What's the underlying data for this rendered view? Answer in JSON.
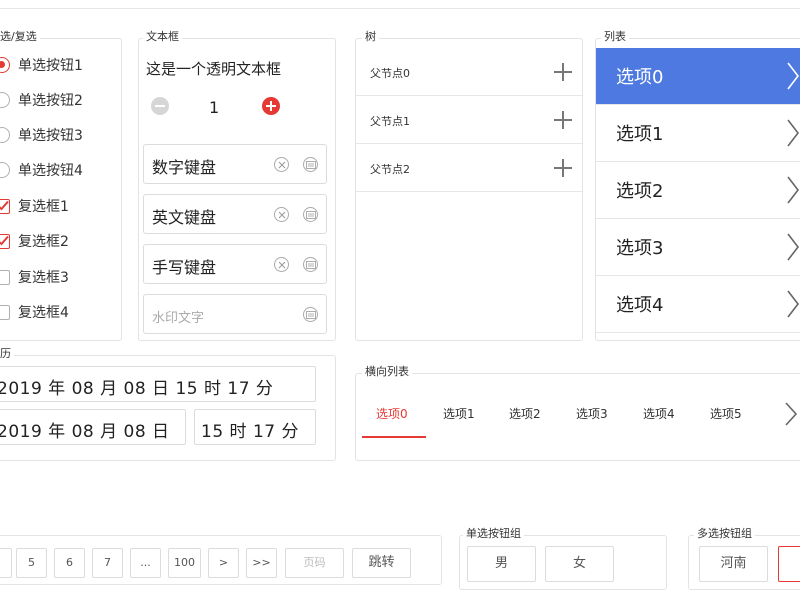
{
  "radio_panel": {
    "title": "选/复选",
    "radios": [
      {
        "label": "单选按钮1",
        "checked": true
      },
      {
        "label": "单选按钮2",
        "checked": false
      },
      {
        "label": "单选按钮3",
        "checked": false
      },
      {
        "label": "单选按钮4",
        "checked": false
      }
    ],
    "checkboxes": [
      {
        "label": "复选框1",
        "checked": true
      },
      {
        "label": "复选框2",
        "checked": true
      },
      {
        "label": "复选框3",
        "checked": false
      },
      {
        "label": "复选框4",
        "checked": false
      }
    ]
  },
  "textbox_panel": {
    "title": "文本框",
    "transparent_text": "这是一个透明文本框",
    "stepper_value": "1",
    "fields": [
      {
        "value": "数字键盘",
        "clearable": true
      },
      {
        "value": "英文键盘",
        "clearable": true
      },
      {
        "value": "手写键盘",
        "clearable": true
      }
    ],
    "watermark_placeholder": "水印文字"
  },
  "tree_panel": {
    "title": "树",
    "nodes": [
      "父节点0",
      "父节点1",
      "父节点2"
    ]
  },
  "list_panel": {
    "title": "列表",
    "items": [
      "选项0",
      "选项1",
      "选项2",
      "选项3",
      "选项4"
    ],
    "active_index": 0
  },
  "calendar_panel": {
    "title": "历",
    "row1": "2019 年 08 月 08 日 15 时 17 分",
    "row2_date": "2019 年 08 月 08 日",
    "row2_time": "15 时 17 分"
  },
  "hlist_panel": {
    "title": "横向列表",
    "items": [
      "选项0",
      "选项1",
      "选项2",
      "选项3",
      "选项4",
      "选项5"
    ],
    "active_index": 0
  },
  "pager": {
    "pages": [
      "5",
      "6",
      "7",
      "...",
      "100"
    ],
    "next": ">",
    "last": ">>",
    "page_input_placeholder": "页码",
    "jump_label": "跳转"
  },
  "radio_group": {
    "title": "单选按钮组",
    "options": [
      "男",
      "女"
    ]
  },
  "multi_group": {
    "title": "多选按钮组",
    "options": [
      "河南"
    ]
  },
  "colors": {
    "accent": "#e53935",
    "list_active": "#4d79e0",
    "border": "#dcdcdc"
  }
}
